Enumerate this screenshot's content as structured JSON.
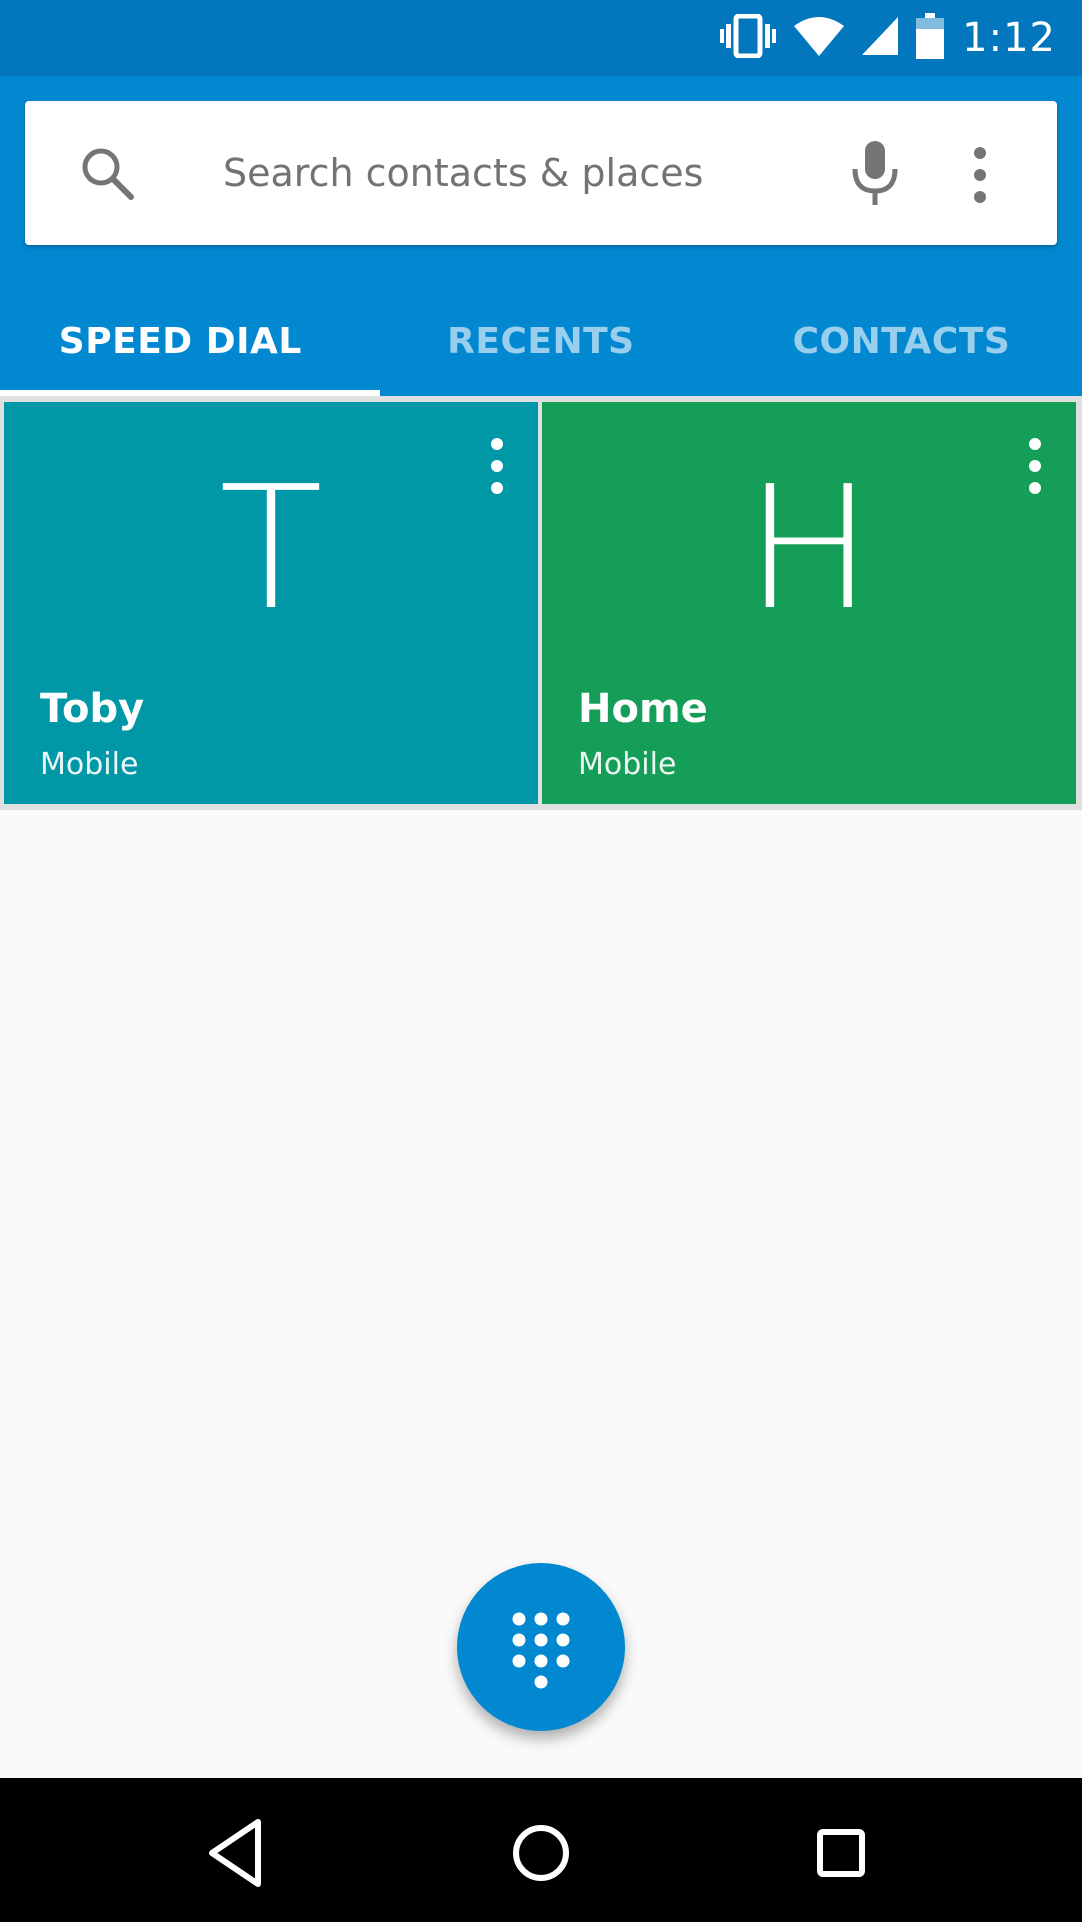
{
  "status_bar": {
    "time": "1:12",
    "icons": [
      "vibrate-icon",
      "wifi-icon",
      "cell-signal-icon",
      "battery-icon"
    ]
  },
  "search": {
    "placeholder": "Search contacts & places",
    "icons": [
      "search-icon",
      "mic-icon",
      "overflow-menu-icon"
    ]
  },
  "tabs": [
    {
      "label": "SPEED DIAL",
      "active": true
    },
    {
      "label": "RECENTS",
      "active": false
    },
    {
      "label": "CONTACTS",
      "active": false
    }
  ],
  "speed_dial": [
    {
      "letter": "T",
      "name": "Toby",
      "type": "Mobile",
      "color": "#0097a7"
    },
    {
      "letter": "H",
      "name": "Home",
      "type": "Mobile",
      "color": "#159e58"
    }
  ],
  "fab": {
    "icon": "dialpad-icon",
    "color": "#0288d1"
  },
  "nav_bar": {
    "icons": [
      "back-icon",
      "home-icon",
      "recents-icon"
    ]
  },
  "colors": {
    "status_bar": "#0277bd",
    "app_bar": "#0288d1",
    "background": "#fafafa"
  }
}
